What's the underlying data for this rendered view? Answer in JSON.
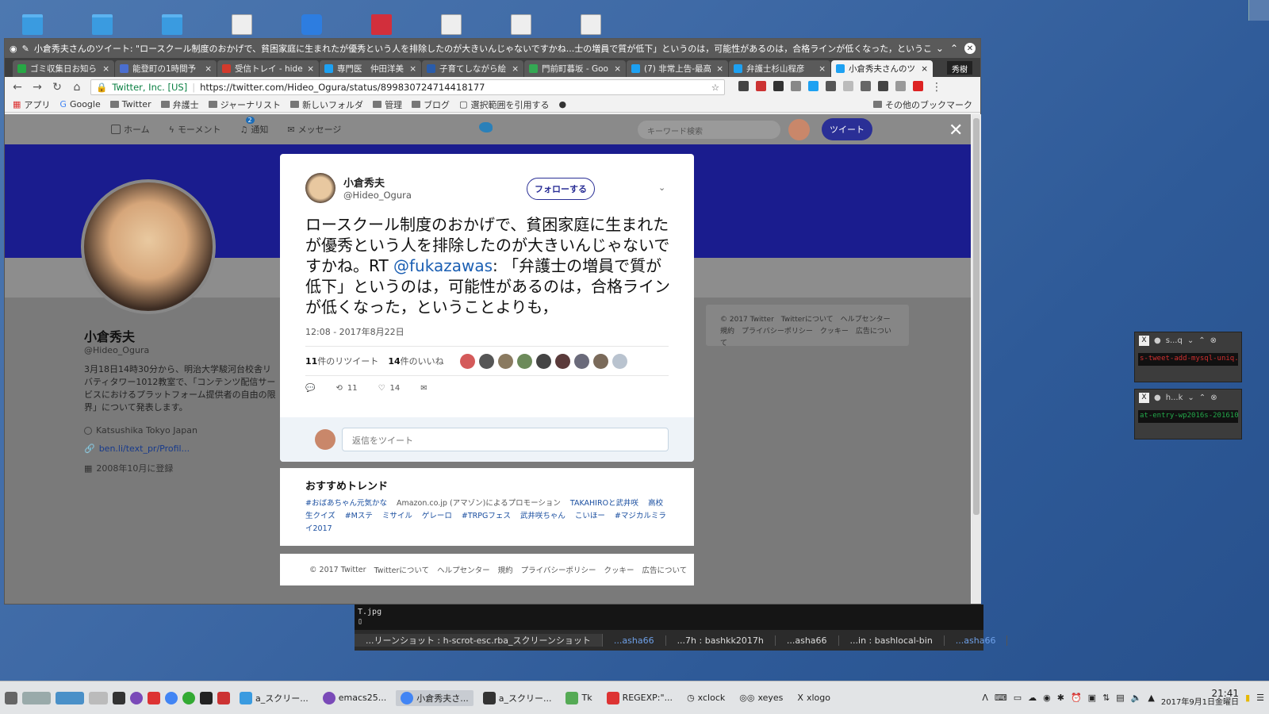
{
  "chrome": {
    "window_title": "小倉秀夫さんのツイート: \"ロースクール制度のおかげで、貧困家庭に生まれたが優秀という人を排除したのが大きいんじゃないですかね...士の増員で質が低下」というのは，可能性があるのは，合格ラインが低くなった，ということよりも，\" - Google Chrome",
    "tabs": [
      {
        "label": "ゴミ収集日お知ら",
        "color": "#27a845"
      },
      {
        "label": "能登町の1時間予",
        "color": "#4a6ecf"
      },
      {
        "label": "受信トレイ - hide",
        "color": "#d33a2c"
      },
      {
        "label": "専門医　仲田洋美",
        "color": "#1da1f2"
      },
      {
        "label": "子育てしながら絵",
        "color": "#2a5caa"
      },
      {
        "label": "門前町暮坂 - Goo",
        "color": "#34a853"
      },
      {
        "label": "(7) 非常上告-最高",
        "color": "#1da1f2"
      },
      {
        "label": "弁護士杉山程彦",
        "color": "#1da1f2"
      },
      {
        "label": "小倉秀夫さんのツ",
        "color": "#1da1f2"
      }
    ],
    "profile_label": "秀樹",
    "security_label": "Twitter, Inc. [US]",
    "url": "https://twitter.com/Hideo_Ogura/status/899830724714418177",
    "bookmarks": [
      "アプリ",
      "Google",
      "Twitter",
      "弁護士",
      "ジャーナリスト",
      "新しいフォルダ",
      "管理",
      "ブログ",
      "選択範囲を引用する"
    ],
    "bookmarks_other": "その他のブックマーク"
  },
  "twitter_nav": {
    "home": "ホーム",
    "moments": "モーメント",
    "notifications": "通知",
    "notif_count": "2",
    "messages": "メッセージ",
    "search_placeholder": "キーワード検索",
    "tweet_button": "ツイート"
  },
  "profile": {
    "name": "小倉秀夫",
    "handle": "@Hideo_Ogura",
    "bio": "3月18日14時30分から、明治大学駿河台校舎リバティタワー1012教室で、「コンテンツ配信サービスにおけるプラットフォーム提供者の自由の限界」について発表します。",
    "location": "Katsushika Tokyo Japan",
    "link": "ben.li/text_pr/Profil...",
    "joined": "2008年10月に登録",
    "footer": "© 2017 Twitter　Twitterについて　ヘルプセンター　規約　プライバシーポリシー　クッキー　広告について"
  },
  "tweet": {
    "name": "小倉秀夫",
    "handle": "@Hideo_Ogura",
    "follow_label": "フォローする",
    "text_before": "ロースクール制度のおかげで、貧困家庭に生まれたが優秀という人を排除したのが大きいんじゃないですかね。RT ",
    "mention": "@fukazawas",
    "text_after": ": 「弁護士の増員で質が低下」というのは，可能性があるのは，合格ラインが低くなった，ということよりも，",
    "date": "12:08 - 2017年8月22日",
    "retweets_count": "11",
    "retweets_label": "件のリツイート",
    "likes_count": "14",
    "likes_label": "件のいいね",
    "action_retweets": "11",
    "action_likes": "14",
    "reply_placeholder": "返信をツイート",
    "liker_colors": [
      "#d45a5a",
      "#555555",
      "#8a7a60",
      "#6c8a5a",
      "#444444",
      "#5a3a3a",
      "#6a6a7a",
      "#7a6a5a",
      "#b9c3cf"
    ]
  },
  "trends": {
    "title": "おすすめトレンド",
    "items": [
      "#おばあちゃん元気かな",
      "Amazon.co.jp (アマゾン)によるプロモーション",
      "TAKAHIROと武井咲",
      "高校生クイズ",
      "#Mステ",
      "ミサイル",
      "ゲレーロ",
      "#TRPGフェス",
      "武井咲ちゃん",
      "こいほー",
      "#マジカルミライ2017"
    ]
  },
  "footer_links": [
    "© 2017 Twitter",
    "Twitterについて",
    "ヘルプセンター",
    "規約",
    "プライバシーポリシー",
    "クッキー",
    "広告について"
  ],
  "terminal": {
    "line1": "T.jpg",
    "tabs": [
      "...リーンショット : h-scrot-esc.rba_スクリーンショット",
      "...asha66",
      "...7h : bashkk2017h",
      "...asha66",
      "...in : bashlocal-bin",
      "...asha66"
    ]
  },
  "mini_windows": [
    {
      "title": "s...q",
      "body": "s-tweet-add-mysql-uniq.rb"
    },
    {
      "title": "h...k",
      "body": "at-entry-wp2016s-201610"
    }
  ],
  "taskbar": {
    "tasks": [
      "a_スクリー...",
      "emacs25...",
      "小倉秀夫さ...",
      "a_スクリー...",
      "Tk",
      "REGEXP:\"...",
      "xclock",
      "xeyes",
      "xlogo"
    ],
    "time": "21:41",
    "date": "2017年9月1日金曜日"
  }
}
